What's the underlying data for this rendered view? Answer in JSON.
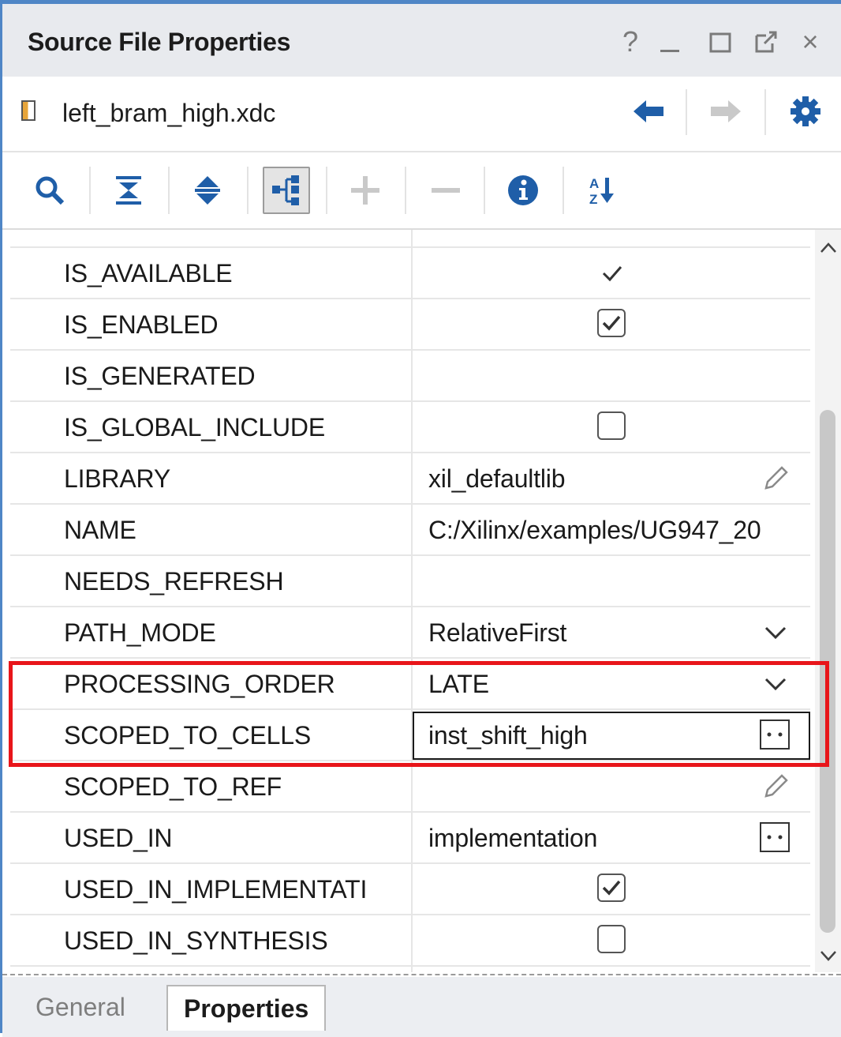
{
  "window": {
    "title": "Source File Properties",
    "controls": {
      "help": "?",
      "close": "×"
    }
  },
  "file": {
    "name": "left_bram_high.xdc"
  },
  "toolbar": {
    "tools": [
      "search-icon",
      "collapse-all-icon",
      "expand-all-icon",
      "group-by-category-icon",
      "add-icon",
      "remove-icon",
      "info-icon",
      "sort-az-icon"
    ]
  },
  "properties": [
    {
      "name": "IS_AVAILABLE",
      "value": "",
      "control": "checkmark"
    },
    {
      "name": "IS_ENABLED",
      "value": "",
      "control": "checkbox",
      "checked": true
    },
    {
      "name": "IS_GENERATED",
      "value": "",
      "control": "none"
    },
    {
      "name": "IS_GLOBAL_INCLUDE",
      "value": "",
      "control": "checkbox",
      "checked": false
    },
    {
      "name": "LIBRARY",
      "value": "xil_defaultlib",
      "control": "pencil"
    },
    {
      "name": "NAME",
      "value": "C:/Xilinx/examples/UG947_20",
      "control": "none"
    },
    {
      "name": "NEEDS_REFRESH",
      "value": "",
      "control": "none"
    },
    {
      "name": "PATH_MODE",
      "value": "RelativeFirst",
      "control": "dropdown"
    },
    {
      "name": "PROCESSING_ORDER",
      "value": "LATE",
      "control": "dropdown"
    },
    {
      "name": "SCOPED_TO_CELLS",
      "value": "inst_shift_high",
      "control": "ellipsis"
    },
    {
      "name": "SCOPED_TO_REF",
      "value": "",
      "control": "pencil"
    },
    {
      "name": "USED_IN",
      "value": "implementation",
      "control": "ellipsis"
    },
    {
      "name": "USED_IN_IMPLEMENTATI",
      "value": "",
      "control": "checkbox",
      "checked": true
    },
    {
      "name": "USED_IN_SYNTHESIS",
      "value": "",
      "control": "checkbox",
      "checked": false
    }
  ],
  "tabs": {
    "general": "General",
    "properties": "Properties"
  },
  "colors": {
    "highlight": "#e8151a",
    "accent": "#1f5ea8",
    "frame": "#4f86c6"
  }
}
